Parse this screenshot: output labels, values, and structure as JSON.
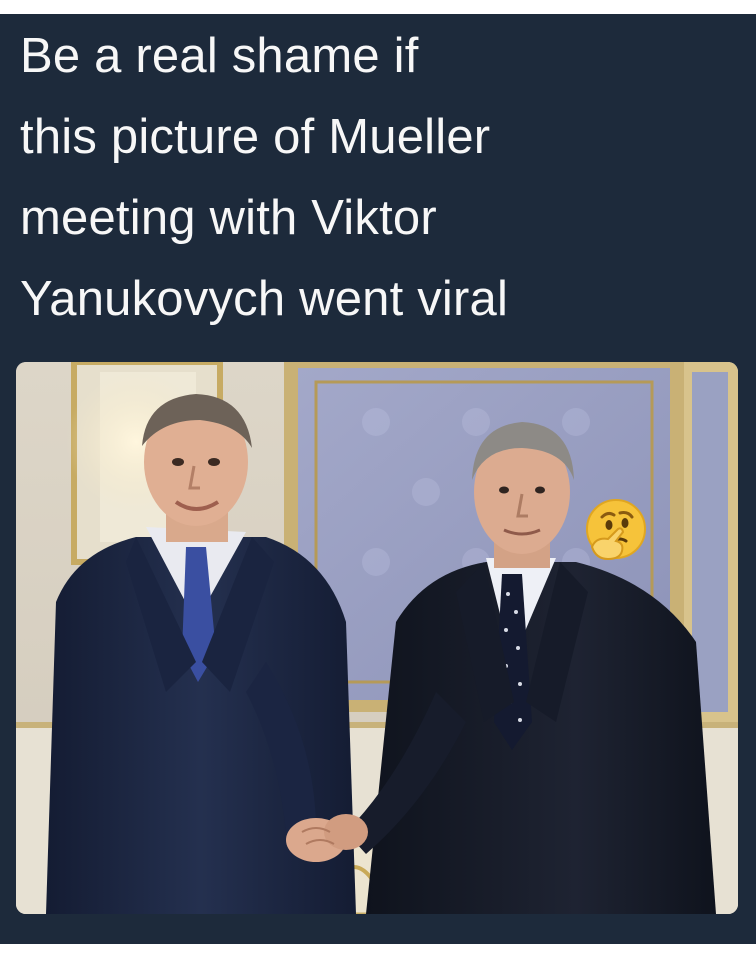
{
  "post": {
    "caption_lines": [
      "Be a real shame if",
      "this picture of Mueller",
      "meeting with Viktor",
      "Yanukovych went viral"
    ],
    "emoji": "thinking-face-icon"
  },
  "colors": {
    "card_background": "#1d2a3b",
    "caption_text": "#f7f7f7",
    "emoji_yellow": "#f6c33a"
  }
}
